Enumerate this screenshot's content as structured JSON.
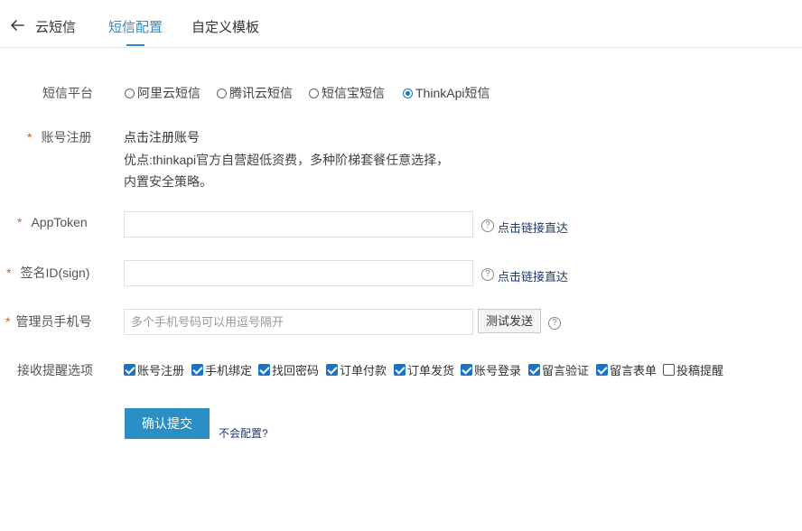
{
  "header": {
    "title": "云短信",
    "tabs": [
      {
        "label": "短信配置",
        "active": true
      },
      {
        "label": "自定义模板",
        "active": false
      }
    ]
  },
  "form": {
    "platform": {
      "label": "短信平台",
      "options": [
        {
          "label": "阿里云短信",
          "checked": false
        },
        {
          "label": "腾讯云短信",
          "checked": false
        },
        {
          "label": "短信宝短信",
          "checked": false
        },
        {
          "label": "ThinkApi短信",
          "checked": true
        }
      ]
    },
    "account": {
      "required_mark": "*",
      "label": "账号注册",
      "link": "点击注册账号",
      "desc_line1": "优点:thinkapi官方自营超低资费，多种阶梯套餐任意选择，",
      "desc_line2": "内置安全策略。"
    },
    "apptoken": {
      "required_mark": "*",
      "label": "AppToken",
      "value": "",
      "help_link": "点击链接直达"
    },
    "sign": {
      "required_mark": "*",
      "label": "签名ID(sign)",
      "value": "",
      "help_link": "点击链接直达"
    },
    "admin_phone": {
      "required_mark": "*",
      "label": "管理员手机号",
      "placeholder": "多个手机号码可以用逗号隔开",
      "test_button": "测试发送"
    },
    "notify": {
      "label": "接收提醒选项",
      "options": [
        {
          "label": "账号注册",
          "checked": true
        },
        {
          "label": "手机绑定",
          "checked": true
        },
        {
          "label": "找回密码",
          "checked": true
        },
        {
          "label": "订单付款",
          "checked": true
        },
        {
          "label": "订单发货",
          "checked": true
        },
        {
          "label": "账号登录",
          "checked": true
        },
        {
          "label": "留言验证",
          "checked": true
        },
        {
          "label": "留言表单",
          "checked": true
        },
        {
          "label": "投稿提醒",
          "checked": false
        }
      ]
    },
    "submit_label": "确认提交",
    "help_text": "不会配置?"
  },
  "colors": {
    "accent": "#2d8cc7",
    "required": "#e5541a",
    "checkbox": "#1a73c9",
    "link": "#1e3a6e"
  },
  "icons": {
    "back": "arrow-left-icon",
    "help": "question-circle-icon"
  }
}
